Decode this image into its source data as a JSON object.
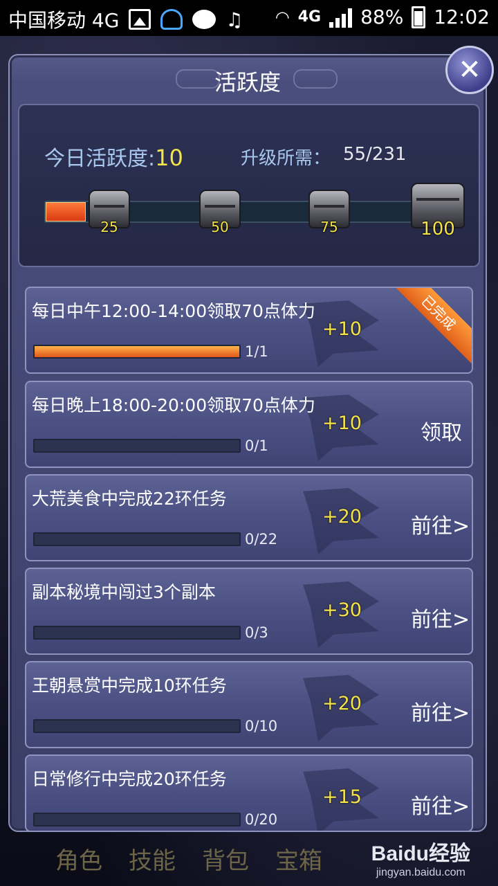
{
  "status_bar": {
    "carrier": "中国移动 4G",
    "network": "4G",
    "battery": "88%",
    "time": "12:02"
  },
  "panel": {
    "title": "活跃度",
    "close_icon": "close-icon"
  },
  "activity": {
    "today_label": "今日活跃度:",
    "today_value": "10",
    "required_label": "升级所需：",
    "required_value": "55/231",
    "progress_fraction": 0.1,
    "milestones": [
      "25",
      "50",
      "75",
      "100"
    ]
  },
  "tasks": [
    {
      "title": "每日中午12:00-14:00领取70点体力",
      "points": "+10",
      "progress": "1/1",
      "fraction": 1,
      "action": "",
      "badge": "已完成"
    },
    {
      "title": "每日晚上18:00-20:00领取70点体力",
      "points": "+10",
      "progress": "0/1",
      "fraction": 0,
      "action": "领取",
      "badge": ""
    },
    {
      "title": "大荒美食中完成22环任务",
      "points": "+20",
      "progress": "0/22",
      "fraction": 0,
      "action": "前往>",
      "badge": ""
    },
    {
      "title": "副本秘境中闯过3个副本",
      "points": "+30",
      "progress": "0/3",
      "fraction": 0,
      "action": "前往>",
      "badge": ""
    },
    {
      "title": "王朝悬赏中完成10环任务",
      "points": "+20",
      "progress": "0/10",
      "fraction": 0,
      "action": "前往>",
      "badge": ""
    },
    {
      "title": "日常修行中完成20环任务",
      "points": "+15",
      "progress": "0/20",
      "fraction": 0,
      "action": "前往>",
      "badge": ""
    }
  ],
  "bottom_nav": [
    "角色",
    "技能",
    "背包",
    "宝箱"
  ],
  "watermark": {
    "main": "Baidu经验",
    "sub": "jingyan.baidu.com"
  }
}
